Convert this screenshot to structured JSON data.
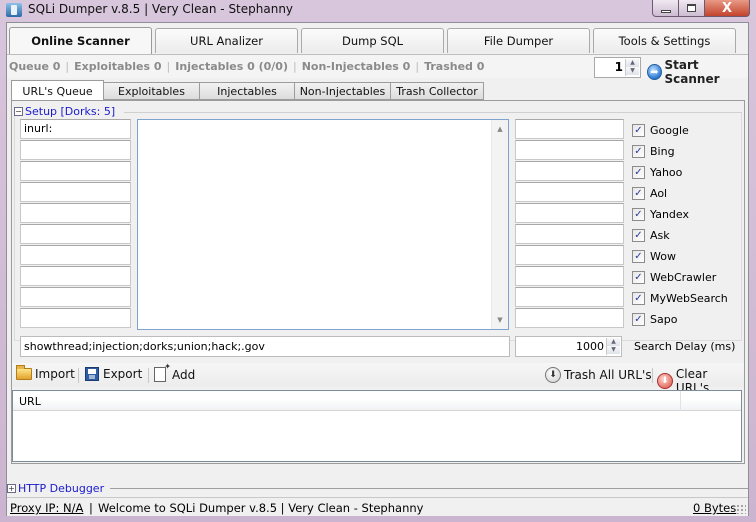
{
  "window": {
    "title": "SQLi Dumper v.8.5 | Very Clean - Stephanny",
    "controls": {
      "minimize": "minimize",
      "maximize": "maximize",
      "close": "X"
    }
  },
  "main_tabs": [
    {
      "label": "Online Scanner",
      "active": true
    },
    {
      "label": "URL Analizer",
      "active": false
    },
    {
      "label": "Dump SQL",
      "active": false
    },
    {
      "label": "File Dumper",
      "active": false
    },
    {
      "label": "Tools & Settings",
      "active": false
    }
  ],
  "stats": {
    "queue": "Queue 0",
    "exploitables": "Exploitables 0",
    "injectables": "Injectables 0 (0/0)",
    "non_injectables": "Non-Injectables 0",
    "trashed": "Trashed 0",
    "separator": "|"
  },
  "scanner": {
    "threads_value": "1",
    "spin_up": "▲",
    "spin_down": "▼",
    "start_label": "Start Scanner",
    "start_icon": "refresh-arrow"
  },
  "sub_tabs": [
    {
      "label": "URL's Queue",
      "active": true
    },
    {
      "label": "Exploitables",
      "active": false
    },
    {
      "label": "Injectables",
      "active": false
    },
    {
      "label": "Non-Injectables",
      "active": false
    },
    {
      "label": "Trash Collector",
      "active": false
    }
  ],
  "setup": {
    "legend": "Setup [Dorks: 5]",
    "collapse_glyph": "−",
    "dork_prefixes": [
      "inurl:",
      "",
      "",
      "",
      "",
      "",
      "",
      "",
      "",
      ""
    ],
    "dorks_text": "",
    "right_fields": [
      "",
      "",
      "",
      "",
      "",
      "",
      "",
      "",
      "",
      ""
    ],
    "engines": [
      {
        "label": "Google",
        "checked": true
      },
      {
        "label": "Bing",
        "checked": true
      },
      {
        "label": "Yahoo",
        "checked": true
      },
      {
        "label": "Aol",
        "checked": true
      },
      {
        "label": "Yandex",
        "checked": true
      },
      {
        "label": "Ask",
        "checked": true
      },
      {
        "label": "Wow",
        "checked": true
      },
      {
        "label": "WebCrawler",
        "checked": true
      },
      {
        "label": "MyWebSearch",
        "checked": true
      },
      {
        "label": "Sapo",
        "checked": true
      }
    ],
    "check_glyph": "✓",
    "keywords": "showthread;injection;dorks;union;hack;.gov",
    "search_delay_value": "1000",
    "search_delay_label": "Search Delay (ms)",
    "scroll_up": "▲",
    "scroll_down": "▼"
  },
  "toolbar": {
    "import_label": "Import",
    "export_label": "Export",
    "add_label": "Add",
    "trash_all_label": "Trash All URL's",
    "clear_label": "Clear URL's",
    "down_glyph": "⬇"
  },
  "url_table": {
    "columns": [
      "URL",
      ""
    ],
    "rows": []
  },
  "http_debugger": {
    "label": "HTTP Debugger",
    "expand_glyph": "+"
  },
  "statusbar": {
    "proxy": "Proxy IP: N/A",
    "pipe": "|",
    "message": "Welcome to SQLi Dumper v.8.5 | Very Clean - Stephanny",
    "bytes": "0 Bytes"
  },
  "colors": {
    "link_blue": "#1a1acc",
    "close_red": "#c3432c",
    "window_frame": "#cdb6cf"
  }
}
